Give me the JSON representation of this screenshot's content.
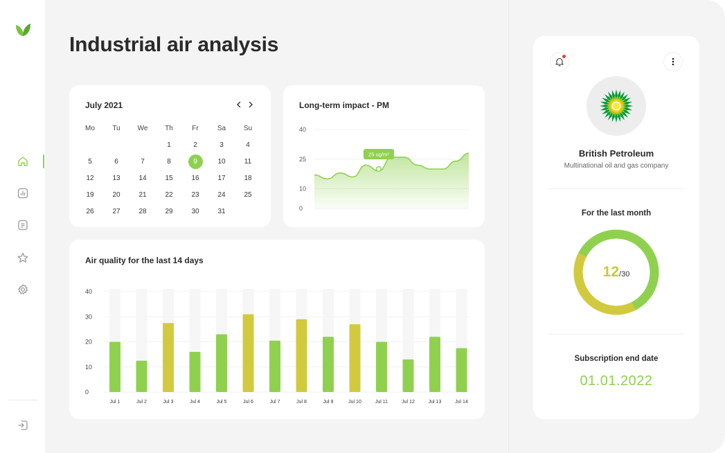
{
  "page": {
    "title": "Industrial air analysis"
  },
  "sidebar": {
    "logo": "leaf-logo",
    "items": [
      {
        "name": "home",
        "icon": "home-icon",
        "active": true
      },
      {
        "name": "reports",
        "icon": "bar-chart-icon",
        "active": false
      },
      {
        "name": "documents",
        "icon": "document-icon",
        "active": false
      },
      {
        "name": "favorites",
        "icon": "star-icon",
        "active": false
      },
      {
        "name": "settings",
        "icon": "gear-icon",
        "active": false
      }
    ],
    "logout": {
      "icon": "logout-icon"
    }
  },
  "calendar": {
    "title": "July 2021",
    "weekdays": [
      "Mo",
      "Tu",
      "We",
      "Th",
      "Fr",
      "Sa",
      "Su"
    ],
    "first_weekday_index": 3,
    "days_in_month": 31,
    "selected_day": 9
  },
  "long_term": {
    "title": "Long-term impact - PM",
    "tooltip": "25 ug/m³"
  },
  "air_quality": {
    "title": "Air quality for the last 14 days"
  },
  "profile": {
    "company_name": "British Petroleum",
    "company_desc": "Multinational oil and gas company",
    "month_title": "For the last month",
    "month_value": "12",
    "month_total": "/30",
    "subscription_title": "Subscription end date",
    "subscription_date": "01.01.2022"
  },
  "colors": {
    "accent_green": "#8fd14f",
    "accent_yellow": "#d2ca3e",
    "notification": "#e0453a"
  },
  "chart_data": [
    {
      "type": "area",
      "title": "Long-term impact - PM",
      "ylim": [
        0,
        40
      ],
      "yticks": [
        0,
        10,
        25,
        40
      ],
      "x": [
        0,
        1,
        2,
        3,
        4,
        5,
        6,
        7,
        8,
        9,
        10,
        11,
        12
      ],
      "values": [
        17,
        15,
        18,
        16,
        22,
        19,
        26,
        26,
        22,
        20,
        20,
        24,
        28
      ],
      "annotation": {
        "x": 5,
        "y": 20,
        "label": "25 ug/m³"
      },
      "grid": true
    },
    {
      "type": "bar",
      "title": "Air quality for the last 14 days",
      "categories": [
        "Jul 1",
        "Jul 2",
        "Jul 3",
        "Jul 4",
        "Jul 5",
        "Jul 6",
        "Jul 7",
        "Jul 8",
        "Jul 9",
        "Jul 10",
        "Jul 11",
        "Jul 12",
        "Jul 13",
        "Jul 14"
      ],
      "values": [
        20,
        12.5,
        27.5,
        16,
        23,
        31,
        20.5,
        29,
        22,
        27,
        20,
        13,
        22,
        17.5
      ],
      "colors": [
        "#8fd14f",
        "#8fd14f",
        "#d2ca3e",
        "#8fd14f",
        "#8fd14f",
        "#d2ca3e",
        "#8fd14f",
        "#d2ca3e",
        "#8fd14f",
        "#d2ca3e",
        "#8fd14f",
        "#8fd14f",
        "#8fd14f",
        "#8fd14f"
      ],
      "ylim": [
        0,
        40
      ],
      "yticks": [
        0,
        10,
        20,
        30,
        40
      ],
      "grid": true
    },
    {
      "type": "pie",
      "title": "For the last month",
      "values": [
        12,
        18
      ],
      "labels": [
        "12",
        "/30"
      ],
      "colors": [
        "#d2ca3e",
        "#8fd14f"
      ]
    }
  ]
}
